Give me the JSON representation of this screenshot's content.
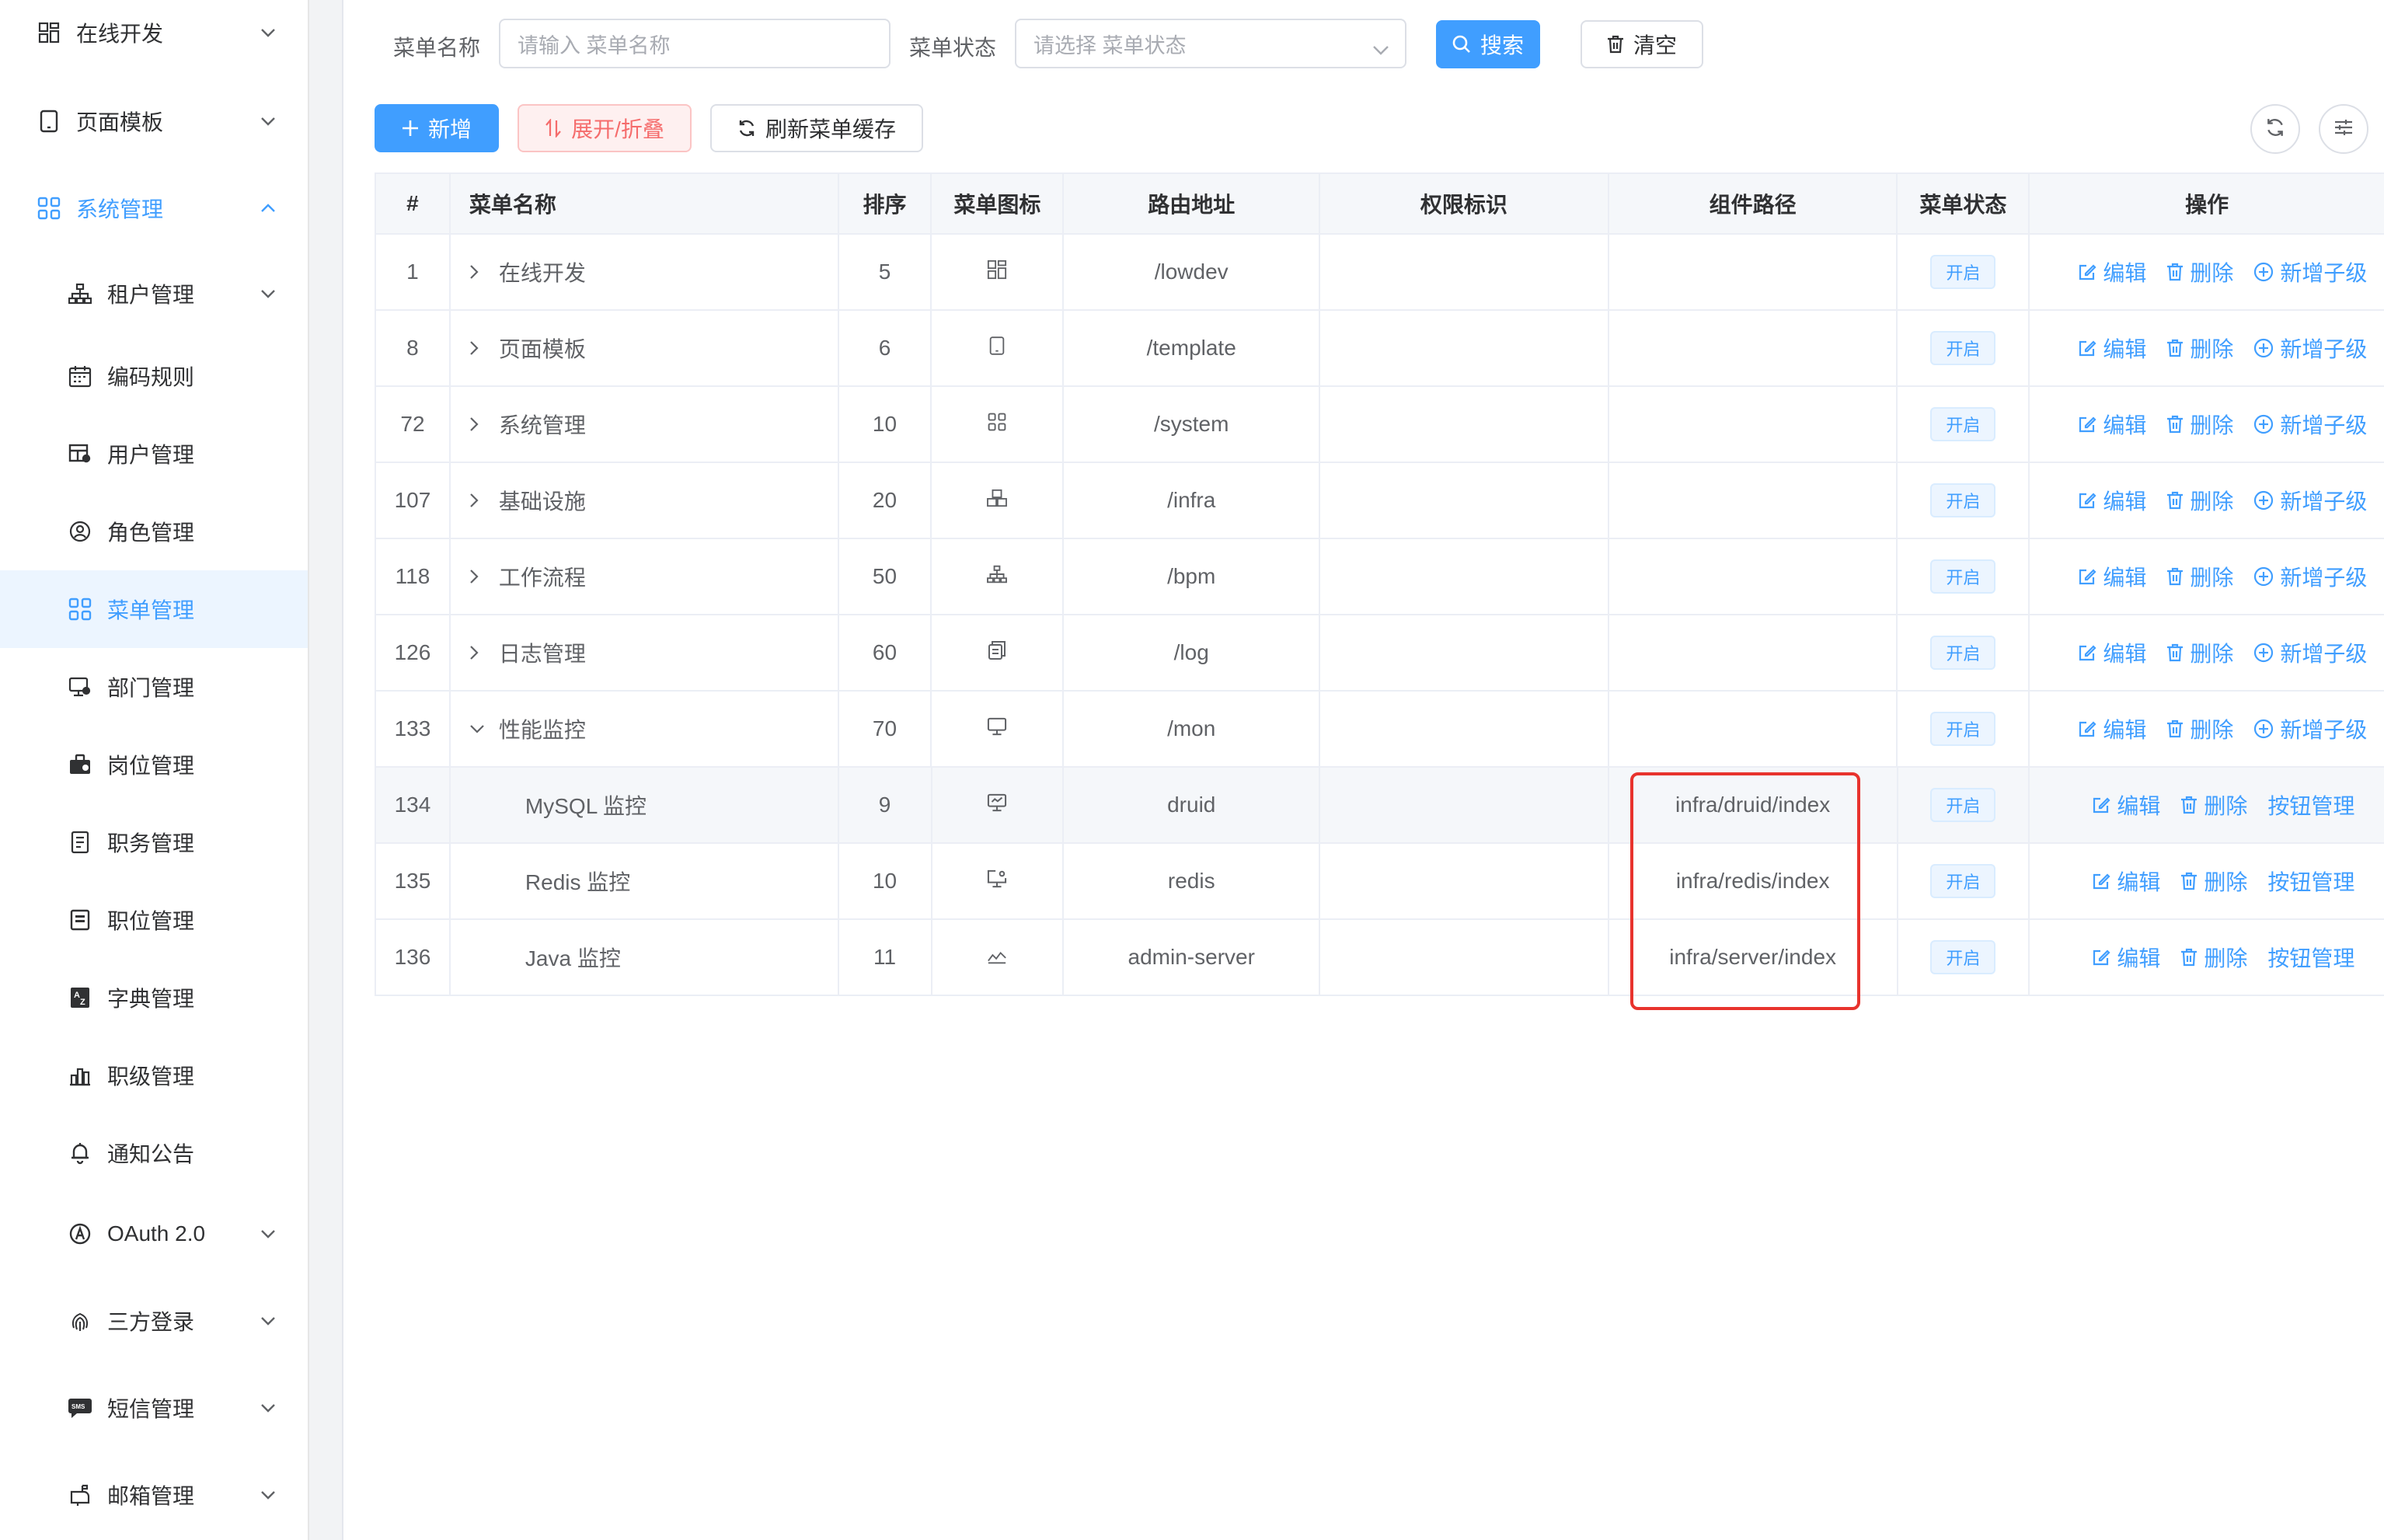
{
  "sidebar": {
    "items": [
      {
        "label": "在线开发",
        "icon": "lowcode-icon",
        "level": 1,
        "has_arrow": true,
        "state": "collapsed"
      },
      {
        "label": "页面模板",
        "icon": "tablet-icon",
        "level": 1,
        "has_arrow": true,
        "state": "collapsed"
      },
      {
        "label": "系统管理",
        "icon": "apps-icon",
        "level": 1,
        "has_arrow": true,
        "state": "expanded"
      },
      {
        "label": "租户管理",
        "icon": "tree-icon",
        "level": 2,
        "has_arrow": true,
        "state": "collapsed"
      },
      {
        "label": "编码规则",
        "icon": "calendar-icon",
        "level": 2,
        "has_arrow": false
      },
      {
        "label": "用户管理",
        "icon": "user-table-icon",
        "level": 2,
        "has_arrow": false
      },
      {
        "label": "角色管理",
        "icon": "role-icon",
        "level": 2,
        "has_arrow": false
      },
      {
        "label": "菜单管理",
        "icon": "apps-icon",
        "level": 2,
        "has_arrow": false,
        "state": "active"
      },
      {
        "label": "部门管理",
        "icon": "dept-icon",
        "level": 2,
        "has_arrow": false
      },
      {
        "label": "岗位管理",
        "icon": "briefcase-icon",
        "level": 2,
        "has_arrow": false
      },
      {
        "label": "职务管理",
        "icon": "document-icon",
        "level": 2,
        "has_arrow": false
      },
      {
        "label": "职位管理",
        "icon": "list-icon",
        "level": 2,
        "has_arrow": false
      },
      {
        "label": "字典管理",
        "icon": "dictionary-icon",
        "level": 2,
        "has_arrow": false
      },
      {
        "label": "职级管理",
        "icon": "bar-chart-icon",
        "level": 2,
        "has_arrow": false
      },
      {
        "label": "通知公告",
        "icon": "bell-icon",
        "level": 2,
        "has_arrow": false
      },
      {
        "label": "OAuth 2.0",
        "icon": "oauth-icon",
        "level": 2,
        "has_arrow": true,
        "state": "collapsed"
      },
      {
        "label": "三方登录",
        "icon": "fingerprint-icon",
        "level": 2,
        "has_arrow": true,
        "state": "collapsed"
      },
      {
        "label": "短信管理",
        "icon": "sms-icon",
        "level": 2,
        "has_arrow": true,
        "state": "collapsed"
      },
      {
        "label": "邮箱管理",
        "icon": "mail-icon",
        "level": 2,
        "has_arrow": true,
        "state": "collapsed"
      }
    ]
  },
  "search": {
    "name_label": "菜单名称",
    "name_placeholder": "请输入 菜单名称",
    "status_label": "菜单状态",
    "status_placeholder": "请选择 菜单状态",
    "search_button": "搜索",
    "clear_button": "清空"
  },
  "toolbar": {
    "add_button": "新增",
    "toggle_button": "展开/折叠",
    "refresh_cache_button": "刷新菜单缓存"
  },
  "table": {
    "columns": [
      "#",
      "菜单名称",
      "排序",
      "菜单图标",
      "路由地址",
      "权限标识",
      "组件路径",
      "菜单状态",
      "操作"
    ],
    "rows": [
      {
        "id": "1",
        "name": "在线开发",
        "sort": "5",
        "icon": "lowcode-icon",
        "path": "/lowdev",
        "perm": "",
        "component": "",
        "status": "开启",
        "tree": "collapsed",
        "child": false,
        "ops": [
          "编辑",
          "删除",
          "新增子级"
        ]
      },
      {
        "id": "8",
        "name": "页面模板",
        "sort": "6",
        "icon": "tablet-icon",
        "path": "/template",
        "perm": "",
        "component": "",
        "status": "开启",
        "tree": "collapsed",
        "child": false,
        "ops": [
          "编辑",
          "删除",
          "新增子级"
        ]
      },
      {
        "id": "72",
        "name": "系统管理",
        "sort": "10",
        "icon": "apps-icon",
        "path": "/system",
        "perm": "",
        "component": "",
        "status": "开启",
        "tree": "collapsed",
        "child": false,
        "ops": [
          "编辑",
          "删除",
          "新增子级"
        ]
      },
      {
        "id": "107",
        "name": "基础设施",
        "sort": "20",
        "icon": "cubes-icon",
        "path": "/infra",
        "perm": "",
        "component": "",
        "status": "开启",
        "tree": "collapsed",
        "child": false,
        "ops": [
          "编辑",
          "删除",
          "新增子级"
        ]
      },
      {
        "id": "118",
        "name": "工作流程",
        "sort": "50",
        "icon": "tree-icon",
        "path": "/bpm",
        "perm": "",
        "component": "",
        "status": "开启",
        "tree": "collapsed",
        "child": false,
        "ops": [
          "编辑",
          "删除",
          "新增子级"
        ]
      },
      {
        "id": "126",
        "name": "日志管理",
        "sort": "60",
        "icon": "copy-icon",
        "path": "/log",
        "perm": "",
        "component": "",
        "status": "开启",
        "tree": "collapsed",
        "child": false,
        "ops": [
          "编辑",
          "删除",
          "新增子级"
        ]
      },
      {
        "id": "133",
        "name": "性能监控",
        "sort": "70",
        "icon": "monitor-icon",
        "path": "/mon",
        "perm": "",
        "component": "",
        "status": "开启",
        "tree": "expanded",
        "child": false,
        "ops": [
          "编辑",
          "删除",
          "新增子级"
        ]
      },
      {
        "id": "134",
        "name": "MySQL 监控",
        "sort": "9",
        "icon": "monitor-chart-icon",
        "path": "druid",
        "perm": "",
        "component": "infra/druid/index",
        "status": "开启",
        "tree": "none",
        "child": true,
        "highlight": true,
        "ops": [
          "编辑",
          "删除",
          "按钮管理"
        ]
      },
      {
        "id": "135",
        "name": "Redis 监控",
        "sort": "10",
        "icon": "monitor-gear-icon",
        "path": "redis",
        "perm": "",
        "component": "infra/redis/index",
        "status": "开启",
        "tree": "none",
        "child": true,
        "ops": [
          "编辑",
          "删除",
          "按钮管理"
        ]
      },
      {
        "id": "136",
        "name": "Java 监控",
        "sort": "11",
        "icon": "line-chart-icon",
        "path": "admin-server",
        "perm": "",
        "component": "infra/server/index",
        "status": "开启",
        "tree": "none",
        "child": true,
        "ops": [
          "编辑",
          "删除",
          "按钮管理"
        ]
      }
    ]
  },
  "colors": {
    "primary": "#409eff",
    "danger": "#f56c6c",
    "annotation_box": "#e8332d"
  }
}
